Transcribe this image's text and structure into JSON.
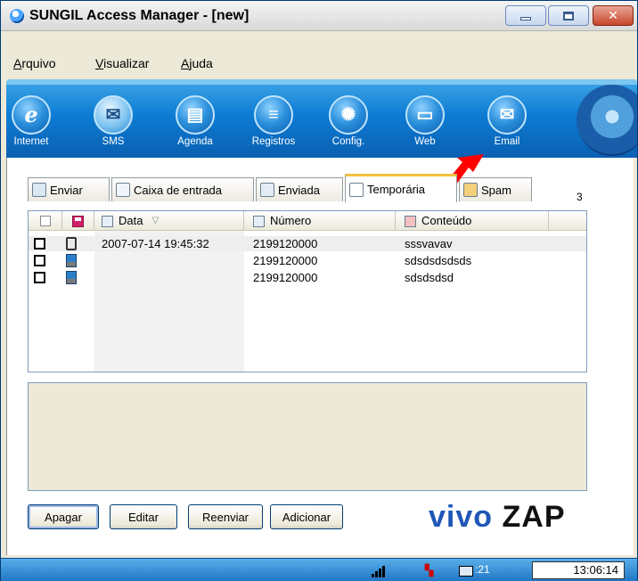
{
  "window": {
    "title": "SUNGIL Access Manager - [new]"
  },
  "menu": {
    "items": [
      "Arquivo",
      "Visualizar",
      "Ajuda"
    ]
  },
  "toolbar": {
    "tools": [
      {
        "label": "Internet",
        "icon": "internet-icon",
        "glyph": "e"
      },
      {
        "label": "SMS",
        "icon": "envelope-icon",
        "glyph": "✉",
        "active": true
      },
      {
        "label": "Agenda",
        "icon": "agenda-icon",
        "glyph": "▤"
      },
      {
        "label": "Registros",
        "icon": "registros-icon",
        "glyph": "≡"
      },
      {
        "label": "Config.",
        "icon": "gear-icon",
        "glyph": "✺"
      },
      {
        "label": "Web",
        "icon": "web-icon",
        "glyph": "▭"
      },
      {
        "label": "Email",
        "icon": "email-icon",
        "glyph": "✉"
      }
    ]
  },
  "tabs": {
    "items": [
      "Enviar",
      "Caixa de entrada",
      "Enviada",
      "Temporária",
      "Spam"
    ],
    "active": "Temporária",
    "count": "3"
  },
  "list": {
    "columns": {
      "date": "Data",
      "number": "Número",
      "content": "Conteúdo"
    },
    "rows": [
      {
        "icon": "phone-icon",
        "date": "2007-07-14 19:45:32",
        "number": "2199120000",
        "content": "sssvavav"
      },
      {
        "icon": "computer-icon",
        "date": "",
        "number": "2199120000",
        "content": "sdsdsdsdsds"
      },
      {
        "icon": "computer-icon",
        "date": "",
        "number": "2199120000",
        "content": "sdsdsdsd"
      }
    ]
  },
  "buttons": {
    "delete": "Apagar",
    "edit": "Editar",
    "resend": "Reenviar",
    "add": "Adicionar"
  },
  "brand": {
    "vivo": "vivo",
    "zap": "ZAP",
    "vivo_color": "#1f57b6"
  },
  "status": {
    "mail_count": ":21",
    "time": "13:06:14"
  },
  "colors": {
    "toolbar": "#0d7cd4",
    "statusbar": "#1f74c4",
    "arrow": "#ff0000"
  }
}
